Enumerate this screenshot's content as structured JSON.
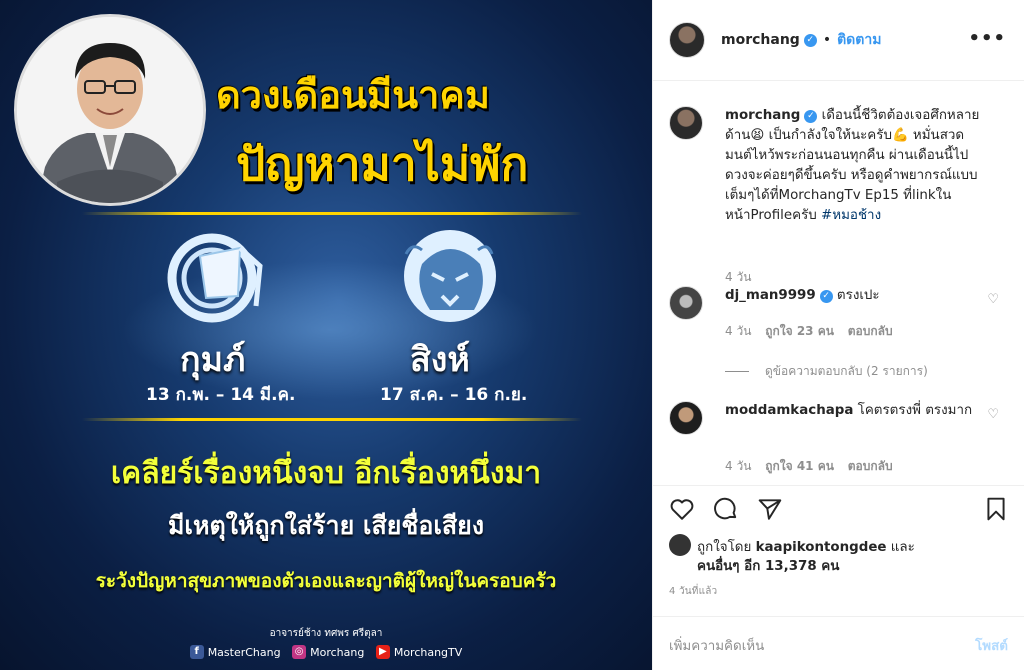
{
  "image": {
    "title_line1": "ดวงเดือนมีนาคม",
    "title_line2": "ปัญหามาไม่พัก",
    "sign1": {
      "name": "กุมภ์",
      "date": "13 ก.พ. – 14 มี.ค."
    },
    "sign2": {
      "name": "สิงห์",
      "date": "17 ส.ค. – 16 ก.ย."
    },
    "line1": "เคลียร์เรื่องหนึ่งจบ อีกเรื่องหนึ่งมา",
    "line2": "มีเหตุให้ถูกใส่ร้าย เสียชื่อเสียง",
    "line3": "ระวังปัญหาสุขภาพของตัวเองและญาติผู้ใหญ่ในครอบครัว",
    "credit": "อาจารย์ช้าง ทศพร ศรีตุลา",
    "social_facebook": "MasterChang",
    "social_instagram": "Morchang",
    "social_youtube": "MorchangTV"
  },
  "header": {
    "username": "morchang",
    "follow_label": "ติดตาม",
    "dot": "•",
    "more_label": "•••"
  },
  "caption": {
    "username": "morchang",
    "text_a": " เดือนนี้ชีวิตต้องเจอศึกหลายด้าน",
    "emoji1": "😫",
    "text_b": " เป็นกำลังใจให้นะครับ",
    "emoji2": "💪",
    "text_c": " หมั่นสวดมนต์ไหว้พระก่อนนอนทุกคืน ผ่านเดือนนี้ไปดวงจะค่อยๆดีขึ้นครับ หรือดูคำพยากรณ์แบบเต็มๆได้ที่MorchangTv Ep15 ที่linkในหน้าProfileครับ ",
    "hashtag": "#หมอช้าง",
    "time": "4 วัน"
  },
  "comments": [
    {
      "username": "dj_man9999",
      "text": " ตรงเปะ",
      "time": "4 วัน",
      "likes": "ถูกใจ 23 คน",
      "reply": "ตอบกลับ"
    },
    {
      "username": "moddamkachapa",
      "text": " โคตรตรงพี่ ตรงมาก",
      "time": "4 วัน",
      "likes": "ถูกใจ 41 คน",
      "reply": "ตอบกลับ"
    }
  ],
  "view_replies": "ดูข้อความตอบกลับ (2 รายการ)",
  "likes": {
    "prefix": "ถูกใจโดย ",
    "user": "kaapikontongdee",
    "mid": " และ",
    "others": "คนอื่นๆ อีก 13,378 คน"
  },
  "posted_ago": "4 วันที่แล้ว",
  "add_comment": {
    "placeholder": "เพิ่มความคิดเห็น",
    "post_label": "โพสต์"
  },
  "colors": {
    "accent": "#3897f0",
    "title_yellow": "#ffd400",
    "bg_blue": "#0b1f44"
  }
}
